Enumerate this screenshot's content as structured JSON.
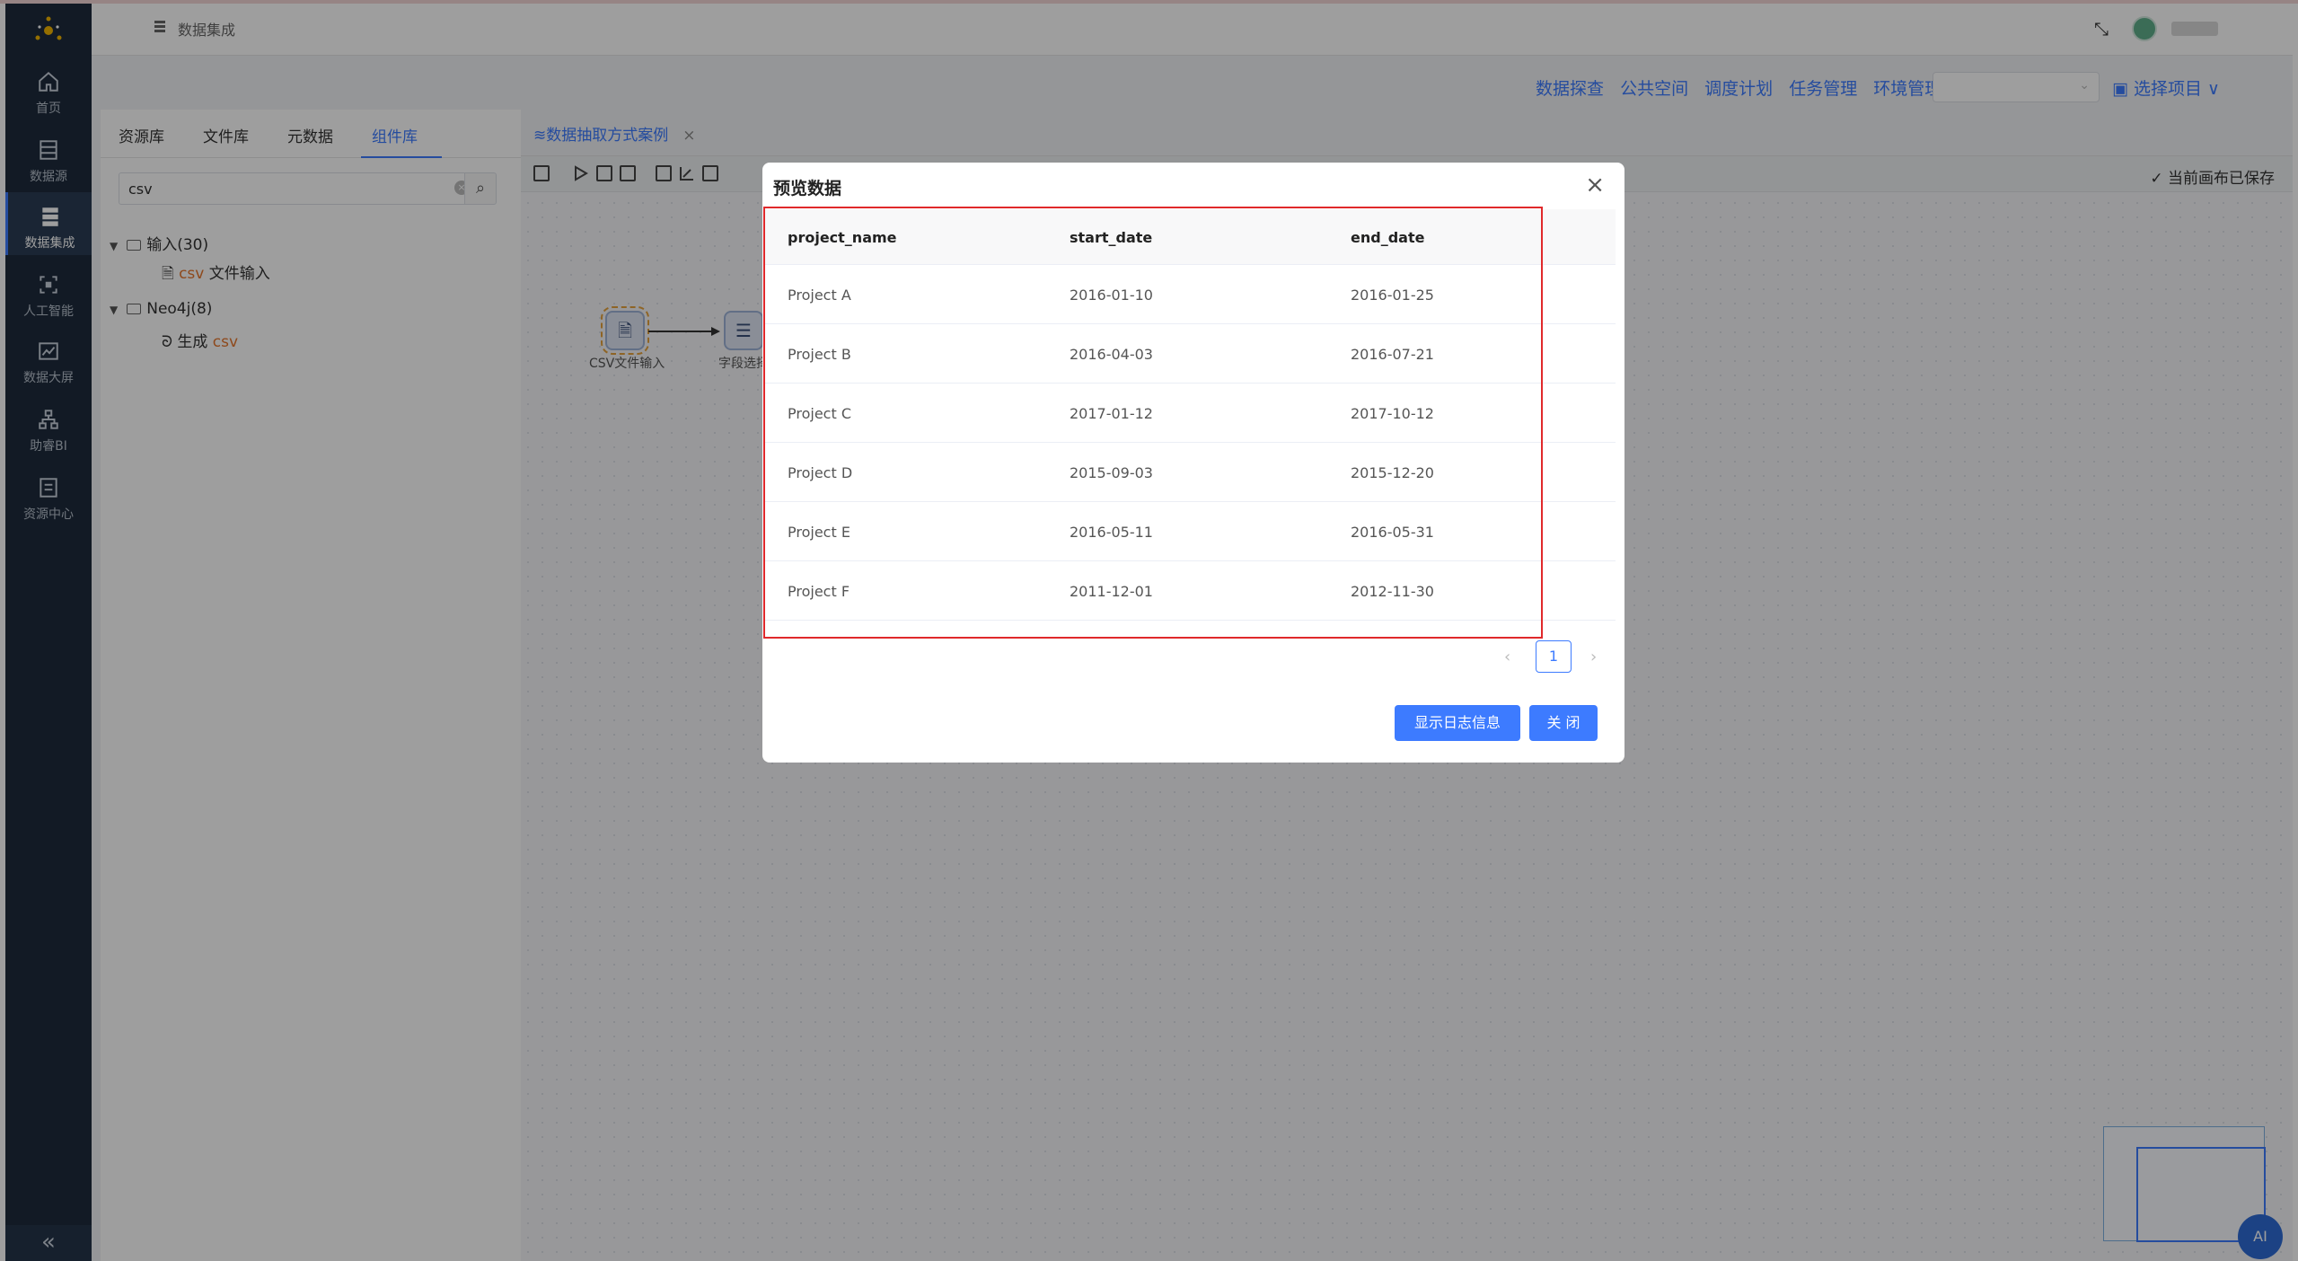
{
  "header": {
    "breadcrumb": "数据集成"
  },
  "sidebar": {
    "items": [
      {
        "label": "首页",
        "icon": "home-icon"
      },
      {
        "label": "数据源",
        "icon": "database-icon"
      },
      {
        "label": "数据集成",
        "icon": "integration-icon"
      },
      {
        "label": "人工智能",
        "icon": "ai-icon"
      },
      {
        "label": "数据大屏",
        "icon": "chart-icon"
      },
      {
        "label": "助睿BI",
        "icon": "bi-icon"
      },
      {
        "label": "资源中心",
        "icon": "resource-icon"
      }
    ],
    "active": "数据集成"
  },
  "topnav": {
    "links": [
      "数据探查",
      "公共空间",
      "调度计划",
      "任务管理",
      "环境管理"
    ],
    "choose_project": "选择项目"
  },
  "left_panel": {
    "tabs": [
      "资源库",
      "文件库",
      "元数据",
      "组件库"
    ],
    "active_tab": "组件库",
    "search_value": "csv",
    "tree": {
      "group1": "输入(30)",
      "item1_prefix": "csv",
      "item1_suffix": " 文件输入",
      "group2": "Neo4j(8)",
      "item2_prefix": "生成 ",
      "item2_suffix": "csv"
    }
  },
  "canvas": {
    "tab": "数据抽取方式案例",
    "saved_status": "当前画布已保存",
    "nodes": [
      "CSV文件输入",
      "字段选择"
    ]
  },
  "modal": {
    "title": "预览数据",
    "columns": [
      "project_name",
      "start_date",
      "end_date"
    ],
    "rows": [
      [
        "Project A",
        "2016-01-10",
        "2016-01-25"
      ],
      [
        "Project B",
        "2016-04-03",
        "2016-07-21"
      ],
      [
        "Project C",
        "2017-01-12",
        "2017-10-12"
      ],
      [
        "Project D",
        "2015-09-03",
        "2015-12-20"
      ],
      [
        "Project E",
        "2016-05-11",
        "2016-05-31"
      ],
      [
        "Project F",
        "2011-12-01",
        "2012-11-30"
      ]
    ],
    "current_page": "1",
    "log_button": "显示日志信息",
    "close_button": "关 闭"
  },
  "ai_button": "AI",
  "accent_color": "#3d7bff"
}
